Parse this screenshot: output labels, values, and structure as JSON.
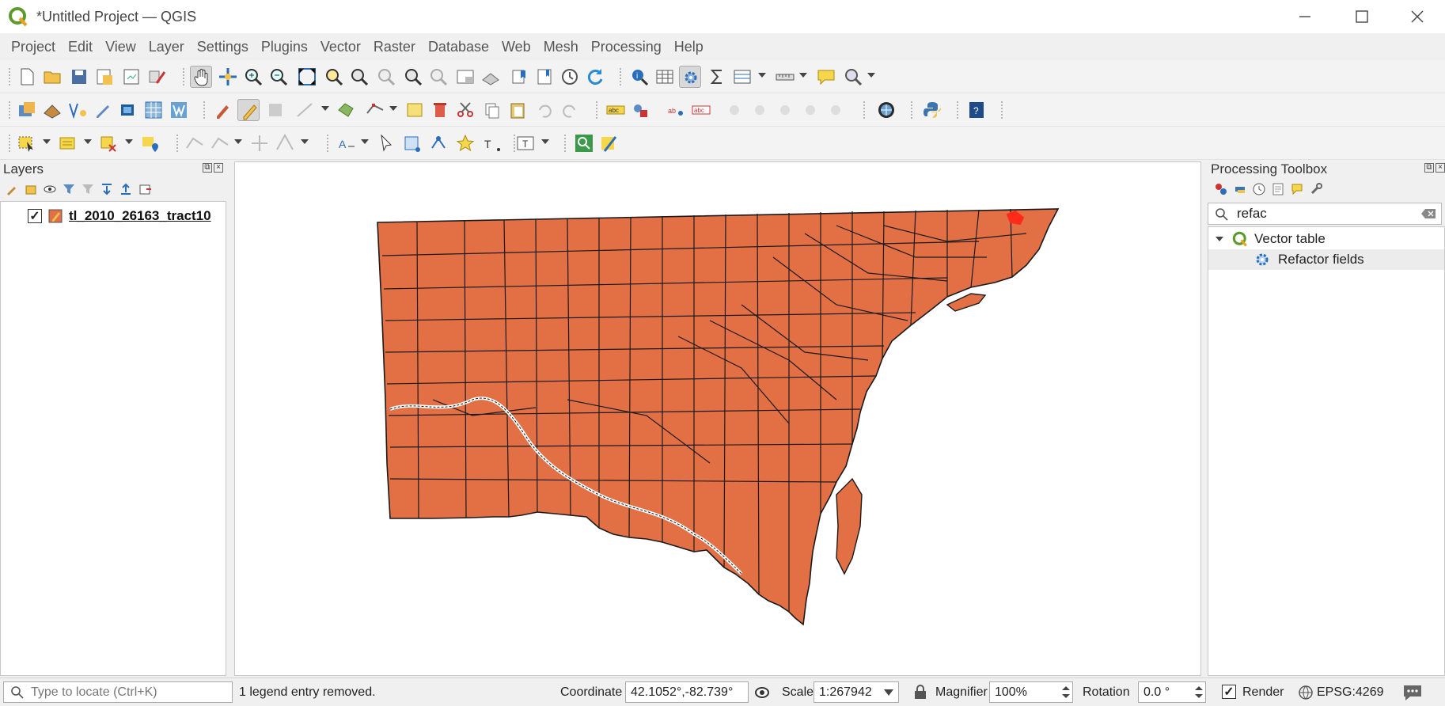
{
  "window": {
    "title": "*Untitled Project — QGIS"
  },
  "menu": [
    "Project",
    "Edit",
    "View",
    "Layer",
    "Settings",
    "Plugins",
    "Vector",
    "Raster",
    "Database",
    "Web",
    "Mesh",
    "Processing",
    "Help"
  ],
  "layers_panel": {
    "title": "Layers",
    "layers": [
      {
        "name": "tl_2010_26163_tract10",
        "checked": true,
        "fill": "#e36f45"
      }
    ]
  },
  "toolbox": {
    "title": "Processing Toolbox",
    "search_value": "refac",
    "group": "Vector table",
    "algorithm": "Refactor fields"
  },
  "status": {
    "locate_placeholder": "Type to locate (Ctrl+K)",
    "message": "1 legend entry removed.",
    "coordinate_label": "Coordinate",
    "coordinate_value": "42.1052°,-82.739°",
    "scale_label": "Scale",
    "scale_value": "1:267942",
    "magnifier_label": "Magnifier",
    "magnifier_value": "100%",
    "rotation_label": "Rotation",
    "rotation_value": "0.0 °",
    "render_label": "Render",
    "crs": "EPSG:4269"
  },
  "colors": {
    "polygon_fill": "#e36f45",
    "polygon_stroke": "#1a1a1a",
    "highlight": "#ff2a1a",
    "accent": "#5d9a2c"
  }
}
